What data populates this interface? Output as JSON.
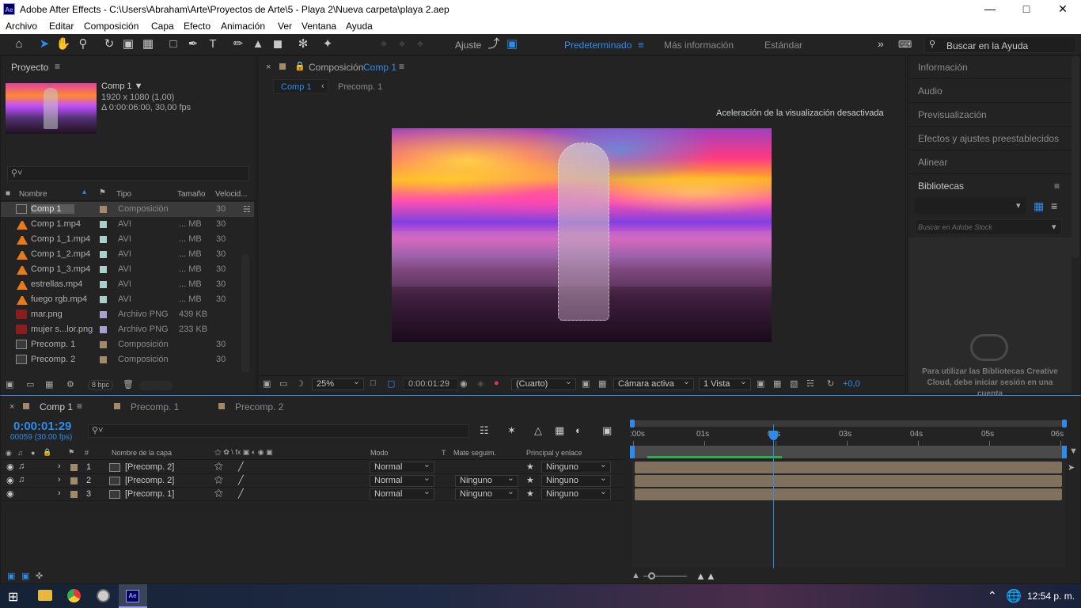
{
  "window": {
    "title": "Adobe After Effects - C:\\Users\\Abraham\\Arte\\Proyectos de Arte\\5 - Playa 2\\Nueva carpeta\\playa 2.aep",
    "app_icon": "Ae"
  },
  "menu": [
    "Archivo",
    "Editar",
    "Composición",
    "Capa",
    "Efecto",
    "Animación",
    "Ver",
    "Ventana",
    "Ayuda"
  ],
  "toolbar": {
    "snapping_label": "Ajuste",
    "workspaces": [
      "Predeterminado",
      "Más información",
      "Estándar"
    ],
    "active_workspace": "Predeterminado",
    "search_placeholder": "Buscar en la Ayuda"
  },
  "project": {
    "title": "Proyecto",
    "selected_name": "Comp 1 ▼",
    "selected_dims": "1920 x 1080 (1,00)",
    "selected_duration": "Δ 0:00:06:00, 30,00 fps",
    "columns": [
      "Nombre",
      "Tipo",
      "Tamaño",
      "Velocid..."
    ],
    "items": [
      {
        "name": "Comp 1",
        "type": "Composición",
        "size": "",
        "fps": "30",
        "icon": "comp",
        "label_color": "#a08a6a"
      },
      {
        "name": "Comp 1.mp4",
        "type": "AVI",
        "size": "... MB",
        "fps": "30",
        "icon": "vlc",
        "label_color": "#a8d0c8"
      },
      {
        "name": "Comp 1_1.mp4",
        "type": "AVI",
        "size": "... MB",
        "fps": "30",
        "icon": "vlc",
        "label_color": "#a8d0c8"
      },
      {
        "name": "Comp 1_2.mp4",
        "type": "AVI",
        "size": "... MB",
        "fps": "30",
        "icon": "vlc",
        "label_color": "#a8d0c8"
      },
      {
        "name": "Comp 1_3.mp4",
        "type": "AVI",
        "size": "... MB",
        "fps": "30",
        "icon": "vlc",
        "label_color": "#a8d0c8"
      },
      {
        "name": "estrellas.mp4",
        "type": "AVI",
        "size": "... MB",
        "fps": "30",
        "icon": "vlc",
        "label_color": "#a8d0c8"
      },
      {
        "name": "fuego rgb.mp4",
        "type": "AVI",
        "size": "... MB",
        "fps": "30",
        "icon": "vlc",
        "label_color": "#a8d0c8"
      },
      {
        "name": "mar.png",
        "type": "Archivo PNG",
        "size": "439 KB",
        "fps": "",
        "icon": "png",
        "label_color": "#a8a0d0"
      },
      {
        "name": "mujer s...lor.png",
        "type": "Archivo PNG",
        "size": "233 KB",
        "fps": "",
        "icon": "png",
        "label_color": "#a8a0d0"
      },
      {
        "name": "Precomp. 1",
        "type": "Composición",
        "size": "",
        "fps": "30",
        "icon": "comp",
        "label_color": "#a08a6a"
      },
      {
        "name": "Precomp. 2",
        "type": "Composición",
        "size": "",
        "fps": "30",
        "icon": "comp",
        "label_color": "#a08a6a"
      }
    ],
    "bpc": "8 bpc"
  },
  "composition": {
    "title": "Composición",
    "comp_name": "Comp 1",
    "tabs": [
      "Comp 1",
      "Precomp. 1"
    ],
    "notice": "Aceleración de la visualización desactivada",
    "zoom": "25%",
    "timecode": "0:00:01:29",
    "resolution": "(Cuarto)",
    "camera": "Cámara activa",
    "views": "1 Vista",
    "exposure": "+0,0"
  },
  "right_panels": {
    "items": [
      "Información",
      "Audio",
      "Previsualización",
      "Efectos y ajustes preestablecidos",
      "Alinear",
      "Bibliotecas"
    ],
    "search_placeholder": "Buscar en Adobe Stock",
    "cc_message": "Para utilizar las Bibliotecas Creative Cloud, debe iniciar sesión en una cuenta"
  },
  "timeline": {
    "tabs": [
      "Comp 1",
      "Precomp. 1",
      "Precomp. 2"
    ],
    "timecode": "0:00:01:29",
    "frame_info": "00059 (30.00 fps)",
    "search_placeholder": "",
    "columns": {
      "layer_name": "Nombre de la capa",
      "mode": "Modo",
      "t": "T",
      "mate": "Mate seguim.",
      "parent": "Principal y enlace"
    },
    "ruler": [
      ":00s",
      "01s",
      "02s",
      "03s",
      "04s",
      "05s",
      "06s"
    ],
    "layers": [
      {
        "num": "1",
        "name": "[Precomp. 2]",
        "mode": "Normal",
        "mate": "",
        "parent": "Ninguno"
      },
      {
        "num": "2",
        "name": "[Precomp. 2]",
        "mode": "Normal",
        "mate": "Ninguno",
        "parent": "Ninguno"
      },
      {
        "num": "3",
        "name": "[Precomp. 1]",
        "mode": "Normal",
        "mate": "Ninguno",
        "parent": "Ninguno"
      }
    ],
    "playhead_seconds": 1.97,
    "duration_seconds": 6
  },
  "taskbar": {
    "time": "12:54 p. m.",
    "ae_icon": "Ae"
  },
  "colors": {
    "accent": "#2d8ceb",
    "bg": "#232323",
    "panel_border": "#1a1a1a",
    "layer_bar": "#7f715e"
  }
}
